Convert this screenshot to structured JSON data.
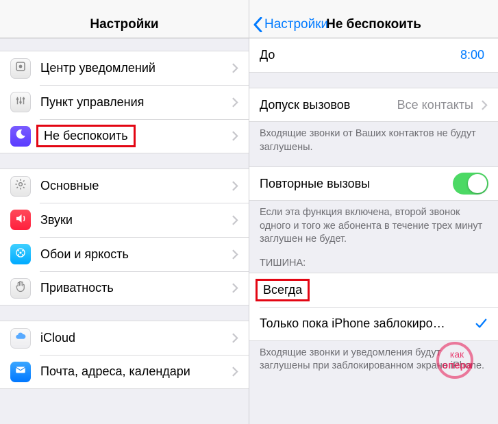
{
  "left": {
    "title": "Настройки",
    "groups": [
      [
        {
          "icon": "notif",
          "label": "Центр уведомлений"
        },
        {
          "icon": "control",
          "label": "Пункт управления"
        },
        {
          "icon": "dnd",
          "label": "Не беспокоить",
          "highlight": true
        }
      ],
      [
        {
          "icon": "general",
          "label": "Основные"
        },
        {
          "icon": "sounds",
          "label": "Звуки"
        },
        {
          "icon": "wall",
          "label": "Обои и яркость"
        },
        {
          "icon": "priv",
          "label": "Приватность"
        }
      ],
      [
        {
          "icon": "icloud",
          "label": "iCloud"
        },
        {
          "icon": "mail",
          "label": "Почта, адреса, календари"
        }
      ]
    ]
  },
  "right": {
    "back_label": "Настройки",
    "title": "Не беспокоить",
    "until_label": "До",
    "until_value": "8:00",
    "allow_label": "Допуск вызовов",
    "allow_value": "Все контакты",
    "allow_footer": "Входящие звонки от Ваших контактов не будут заглушены.",
    "repeat_label": "Повторные вызовы",
    "repeat_on": true,
    "repeat_footer": "Если эта функция включена, второй звонок одного и того же абонента в течение трех минут заглушен не будет.",
    "silence_header": "ТИШИНА:",
    "silence_always": "Всегда",
    "silence_locked": "Только пока iPhone заблокиро…",
    "silence_footer": "Входящие звонки и уведомления будут заглушены при заблокированном экране iPhone."
  },
  "watermark": {
    "line1": "как",
    "line2": "опера"
  }
}
